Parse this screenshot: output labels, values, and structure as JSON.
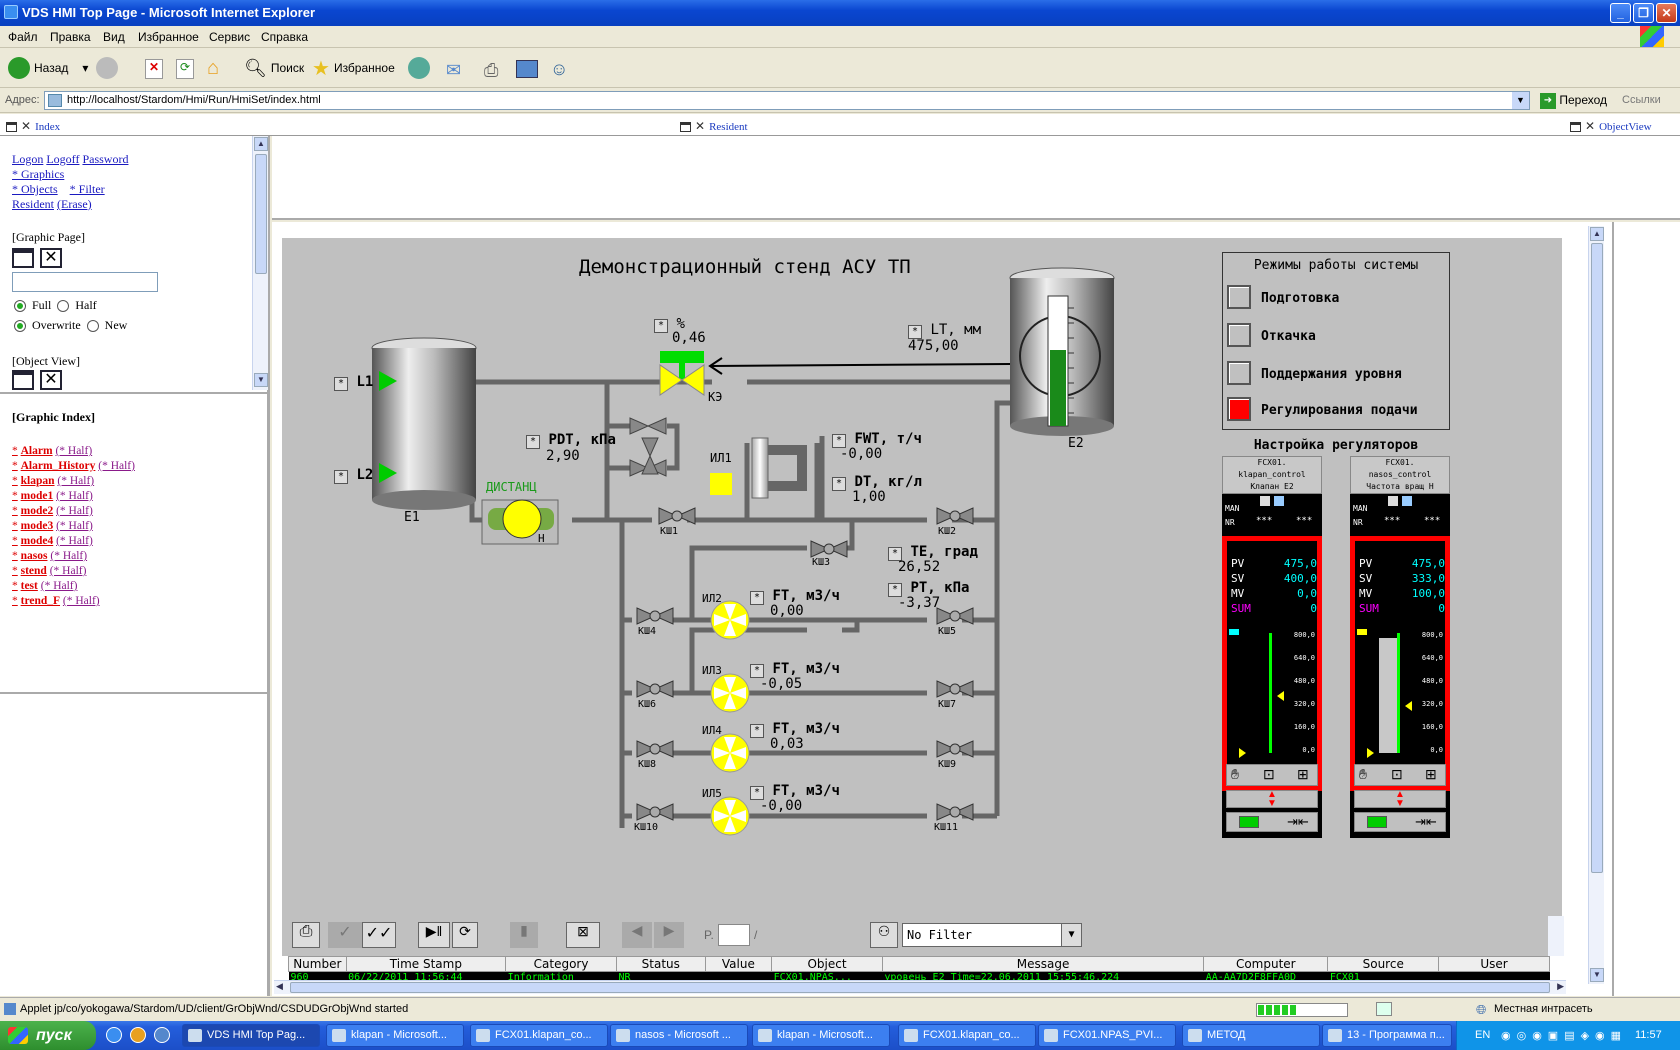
{
  "window": {
    "title": "VDS HMI Top Page - Microsoft Internet Explorer"
  },
  "menu": [
    "Файл",
    "Правка",
    "Вид",
    "Избранное",
    "Сервис",
    "Справка"
  ],
  "toolbar": {
    "back": "Назад",
    "search": "Поиск",
    "favorites": "Избранное"
  },
  "address": {
    "label": "Адрес:",
    "url": "http://localhost/Stardom/Hmi/Run/HmiSet/index.html",
    "go": "Переход",
    "links": "Ссылки"
  },
  "frames": {
    "index": "Index",
    "resident": "Resident",
    "objectview": "ObjectView"
  },
  "left": {
    "logon": "Logon",
    "logoff": "Logoff",
    "password": "Password",
    "graphics": "* Graphics",
    "objects": "* Objects",
    "filter": "* Filter",
    "resident": "Resident",
    "erase": "(Erase)",
    "graphic_page": "[Graphic Page]",
    "full": "Full",
    "half": "Half",
    "overwrite": "Overwrite",
    "new": "New",
    "object_view": "[Object View]",
    "graphic_index": "[Graphic Index]",
    "index_items": [
      "Alarm",
      "Alarm_History",
      "klapan",
      "mode1",
      "mode2",
      "mode3",
      "mode4",
      "nasos",
      "stend",
      "test",
      "trend_F"
    ],
    "half_label": "(* Half)",
    "star": "*"
  },
  "hmi": {
    "title": "Демонстрационный стенд АСУ ТП",
    "percent_label": "%",
    "percent_value": "0,46",
    "lt_label": "LT, мм",
    "lt_value": "475,00",
    "l1": "L1",
    "l2": "L2",
    "e1": "E1",
    "e2": "E2",
    "ke": "КЭ",
    "distanc": "ДИСТАНЦ",
    "n": "Н",
    "pdt_label": "PDT, кПа",
    "pdt_value": "2,90",
    "il1": "ИЛ1",
    "fwt_label": "FWT, т/ч",
    "fwt_value": "-0,00",
    "dt_label": "DT, кг/л",
    "dt_value": "1,00",
    "te_label": "TE, град",
    "te_value": "26,52",
    "pt_label": "PT, кПа",
    "pt_value": "-3,37",
    "ft_label": "FT, м3/ч",
    "ft": [
      {
        "name": "ИЛ2",
        "value": "0,00"
      },
      {
        "name": "ИЛ3",
        "value": "-0,05"
      },
      {
        "name": "ИЛ4",
        "value": "0,03"
      },
      {
        "name": "ИЛ5",
        "value": "-0,00"
      }
    ],
    "valves": [
      "КШ1",
      "КШ2",
      "КШ3",
      "КШ4",
      "КШ5",
      "КШ6",
      "КШ7",
      "КШ8",
      "КШ9",
      "КШ10",
      "КШ11"
    ],
    "modes_title": "Режимы работы системы",
    "modes": [
      {
        "label": "Подготовка",
        "active": false
      },
      {
        "label": "Откачка",
        "active": false
      },
      {
        "label": "Поддержания уровня",
        "active": false
      },
      {
        "label": "Регулирования подачи",
        "active": true
      }
    ],
    "regulators_title": "Настройка регуляторов",
    "regulators": [
      {
        "l1": "FCX01.",
        "l2": "klapan_control",
        "l3": "Клапан Е2",
        "mode": "MAN",
        "nr": "NR",
        "dots": "***",
        "dash": "***",
        "pv": "475,0",
        "sv": "400,0",
        "mv": "0,0",
        "sum": "0",
        "mv_level": 0.0
      },
      {
        "l1": "FCX01.",
        "l2": "nasos_control",
        "l3": "Частота вращ Н",
        "mode": "MAN",
        "nr": "NR",
        "dots": "***",
        "dash": "***",
        "pv": "475,0",
        "sv": "333,0",
        "mv": "100,0",
        "sum": "0",
        "mv_level": 1.0
      }
    ],
    "scale": [
      "800,0",
      "640,0",
      "480,0",
      "320,0",
      "160,0",
      "0,0"
    ],
    "pv_labels": [
      "PV",
      "SV",
      "MV",
      "SUM"
    ]
  },
  "alarm": {
    "page_prefix": "P.",
    "page_sep": "/",
    "filter": "No Filter",
    "columns": [
      "Number",
      "Time Stamp",
      "Category",
      "Status",
      "Value",
      "Object",
      "Message",
      "Computer",
      "Source",
      "User"
    ],
    "row": [
      "960",
      "06/22/2011 11:56:44",
      "Information",
      "NR",
      "",
      "FCX01.NPAS...",
      "уровень Е2 Time=22.06.2011 15:55:46.224",
      "AA-AA7D2F8FFA0D",
      "FCX01",
      ""
    ]
  },
  "status": {
    "text": "Applet jp/co/yokogawa/Stardom/UD/client/GrObjWnd/CSDUDGrObjWnd started",
    "zone": "Местная интрасеть"
  },
  "taskbar": {
    "start": "пуск",
    "tasks": [
      "VDS HMI Top Pag...",
      "klapan - Microsoft...",
      "FCX01.klapan_co...",
      "nasos - Microsoft ...",
      "klapan - Microsoft...",
      "FCX01.klapan_co...",
      "FCX01.NPAS_PVI...",
      "МЕТОД",
      "13 - Программа п..."
    ],
    "lang": "EN",
    "time": "11:57"
  },
  "colors": {
    "active_mode": "#ff0000",
    "pipe": "#777777",
    "valve_green": "#00cc00",
    "regulator_border": "#ff0000"
  }
}
